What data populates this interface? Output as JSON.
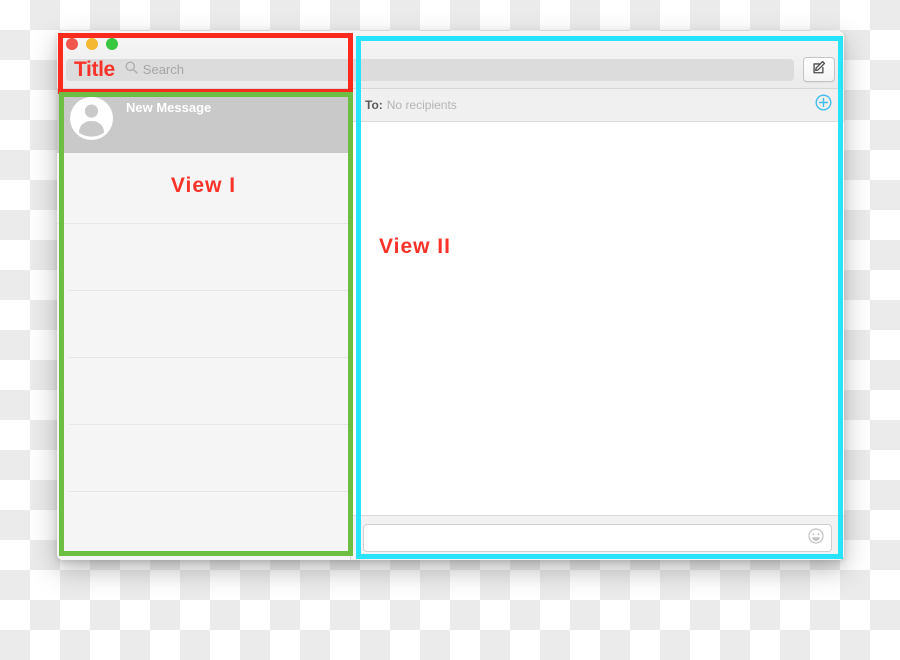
{
  "window": {
    "traffic_lights": [
      {
        "name": "close",
        "color": "#f1564c"
      },
      {
        "name": "minimize",
        "color": "#f5b832"
      },
      {
        "name": "zoom",
        "color": "#3bc640"
      }
    ],
    "titlebar": {
      "title_overlay": "Title",
      "search": {
        "icon": "search-icon",
        "value": "",
        "placeholder": "Search"
      },
      "compose_button": {
        "icon": "compose-icon",
        "label": ""
      }
    }
  },
  "sidebar": {
    "annotation_label": "View I",
    "selected_conversation": {
      "avatar": "person-avatar-icon",
      "title": "New Message"
    },
    "empty_rows": [
      "",
      "",
      "",
      "",
      ""
    ]
  },
  "detail": {
    "annotation_label": "View II",
    "to_bar": {
      "label": "To:",
      "value": "No recipients",
      "add_button_icon": "circle-plus-icon"
    },
    "compose": {
      "value": "",
      "placeholder": "",
      "emoji_button_icon": "smiley-icon"
    }
  },
  "annotations": {
    "red_box_color": "#fa2a1e",
    "green_box_color": "#6fbe44",
    "cyan_box_color": "#27e3fb"
  }
}
